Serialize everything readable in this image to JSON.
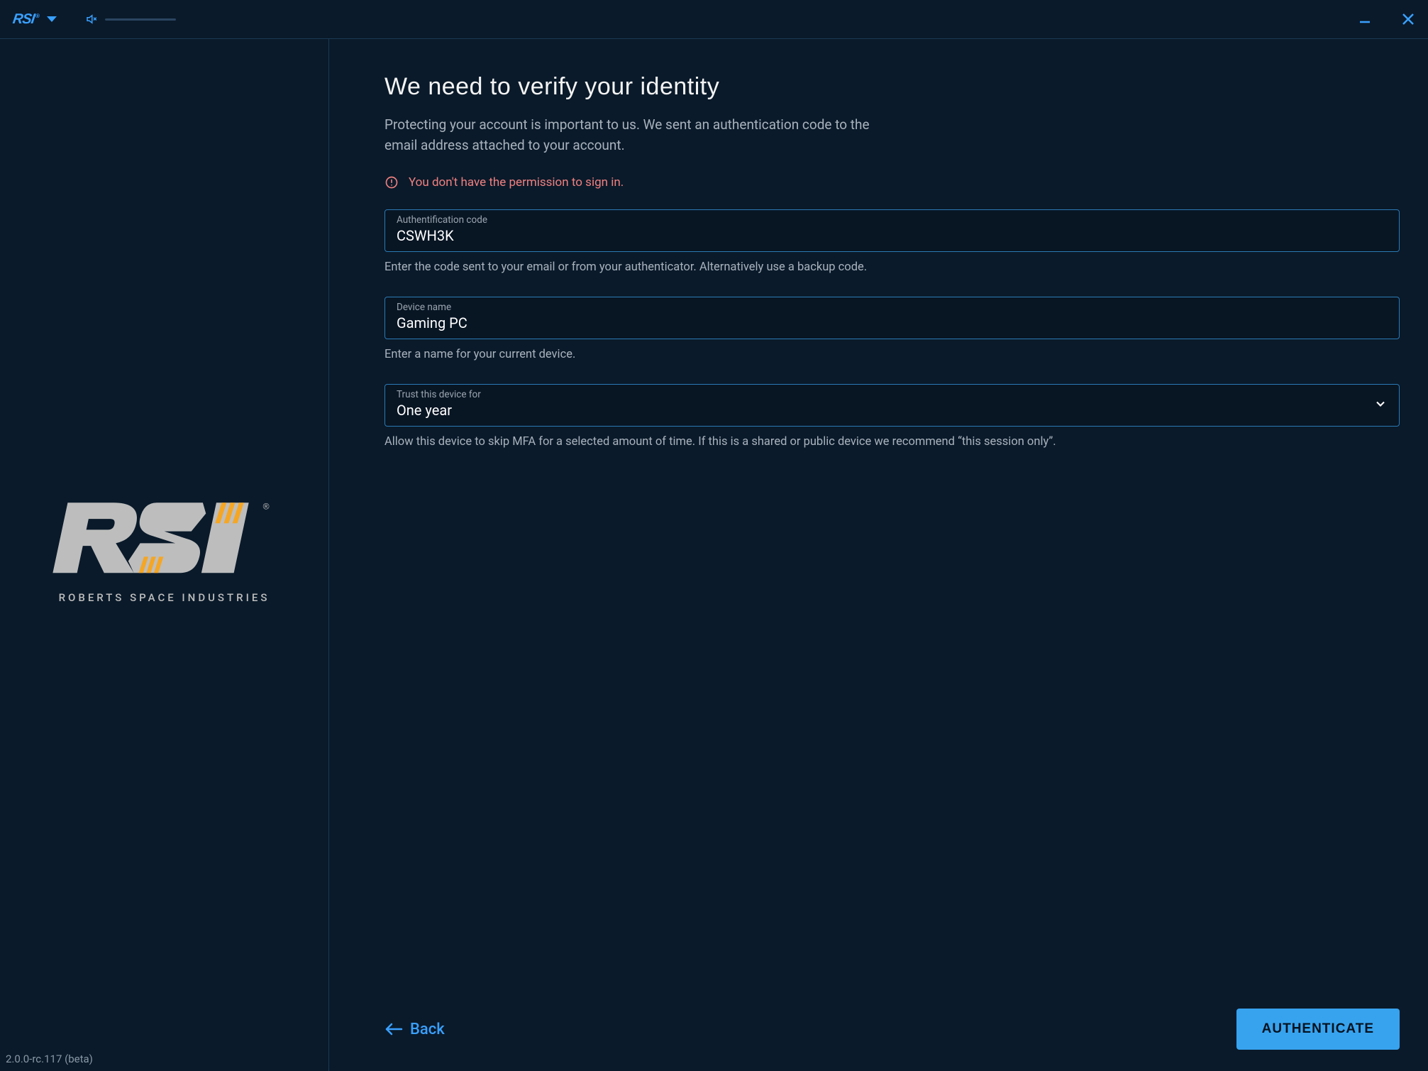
{
  "titlebar": {
    "brand_short": "RSI"
  },
  "brand": {
    "tagline": "ROBERTS SPACE INDUSTRIES"
  },
  "footer": {
    "version": "2.0.0-rc.117 (beta)"
  },
  "page": {
    "title": "We need to verify your identity",
    "subtitle": "Protecting your account is important to us. We sent an authentication code to the email address attached to your account."
  },
  "error": {
    "message": "You don't have the permission to sign in."
  },
  "form": {
    "code": {
      "label": "Authentification code",
      "value": "CSWH3K",
      "help": "Enter the code sent to your email or from your authenticator. Alternatively use a backup code."
    },
    "device": {
      "label": "Device name",
      "value": "Gaming PC",
      "help": "Enter a name for your current device."
    },
    "trust": {
      "label": "Trust this device for",
      "value": "One year",
      "help": "Allow this device to skip MFA for a selected amount of time. If this is a shared or public device we recommend “this session only”."
    }
  },
  "actions": {
    "back": "Back",
    "submit": "AUTHENTICATE"
  }
}
